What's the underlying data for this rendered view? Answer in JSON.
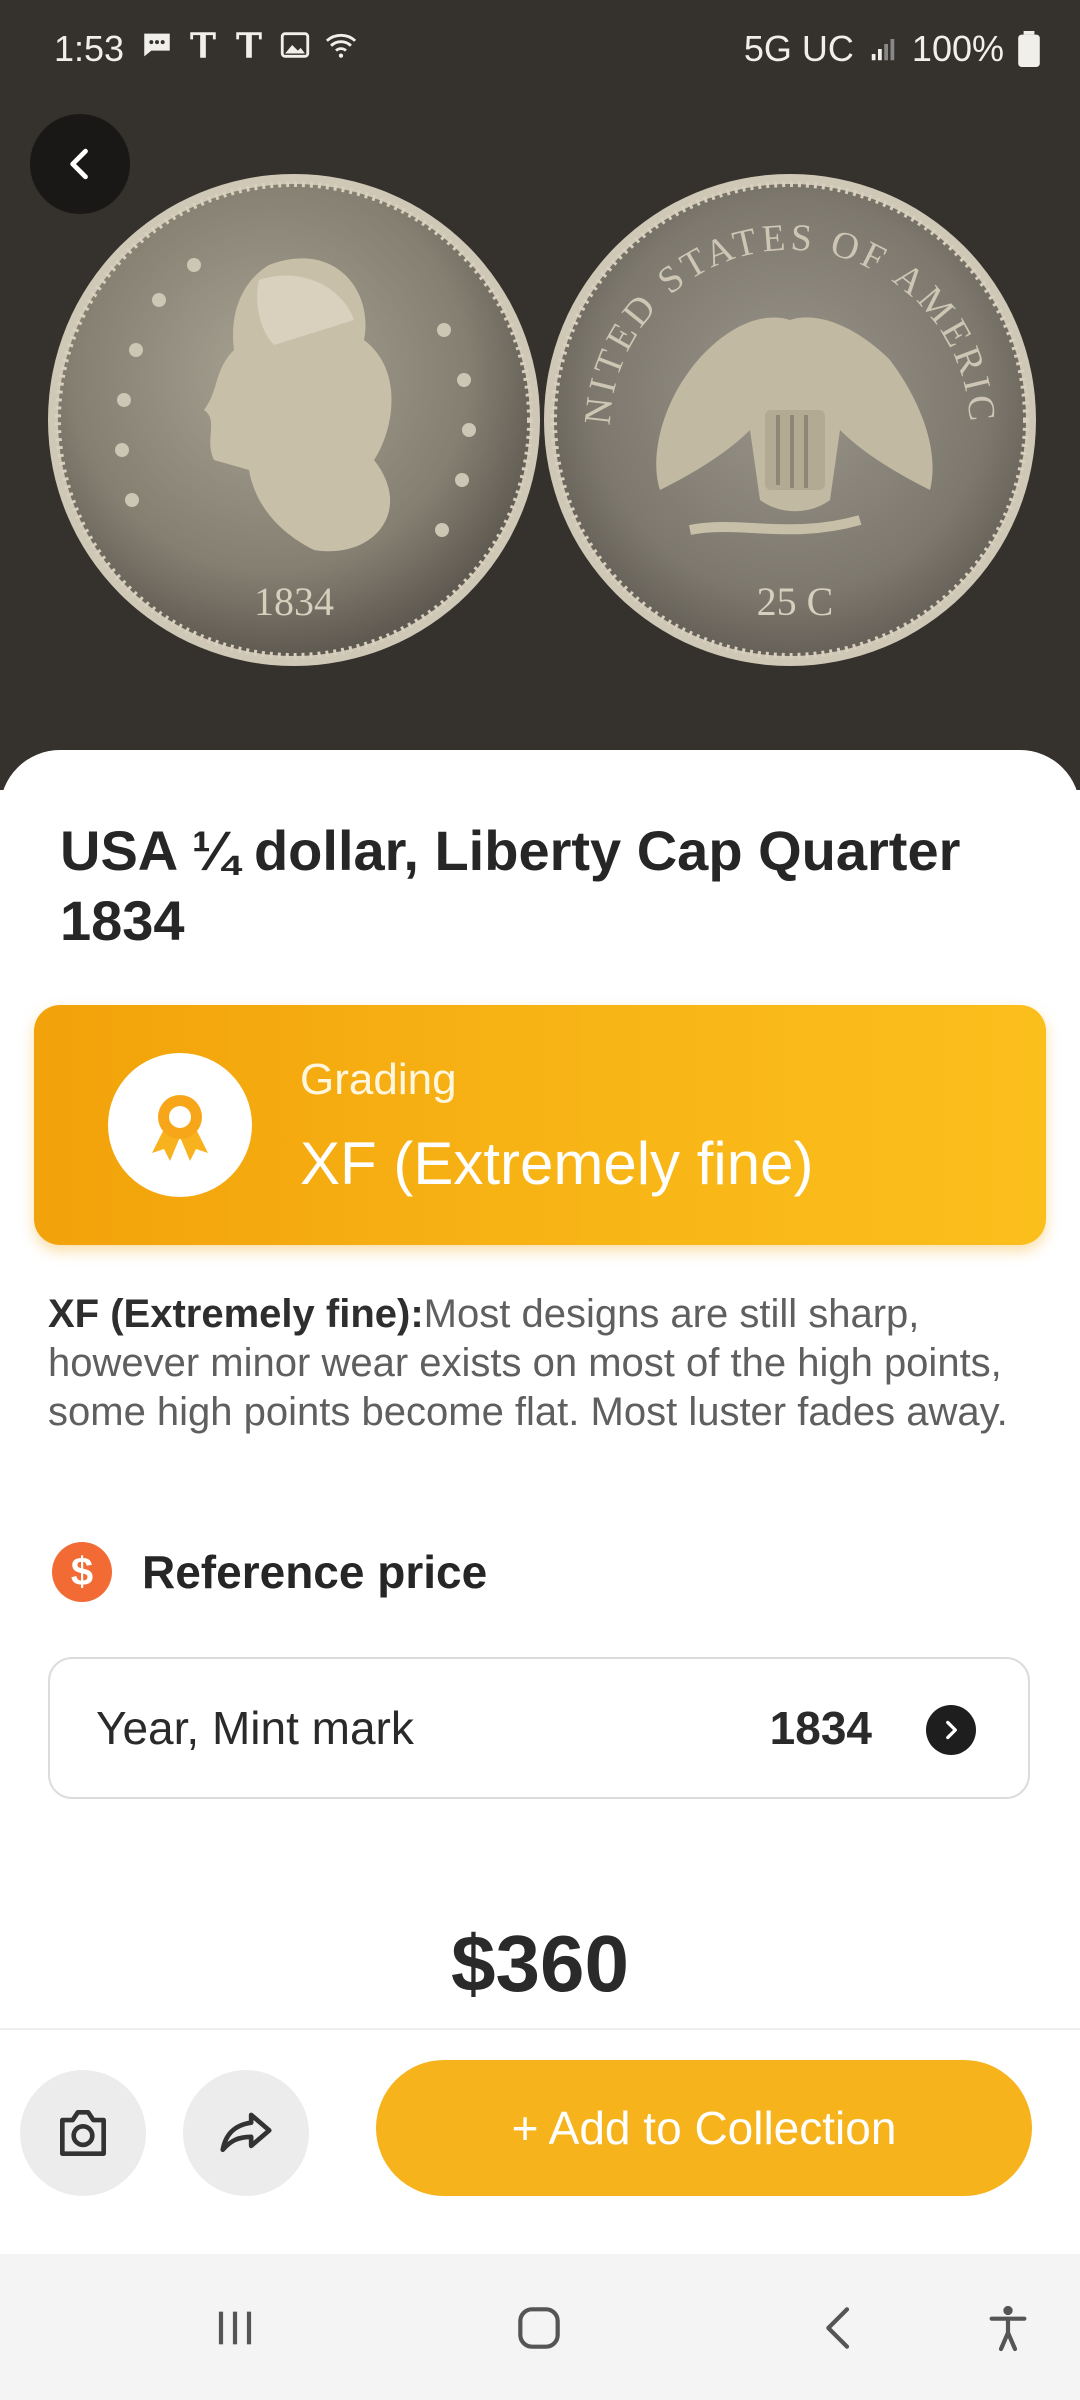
{
  "status_bar": {
    "time": "1:53",
    "network": "5G UC",
    "battery": "100%"
  },
  "hero": {
    "coin_front_year": "1834",
    "coin_back_text": "UNITED STATES OF AMERICA",
    "coin_back_value": "25 C"
  },
  "coin": {
    "title": "USA ¼ dollar, Liberty Cap Quarter 1834"
  },
  "grading": {
    "label": "Grading",
    "value": "XF (Extremely fine)"
  },
  "description": {
    "term": "XF (Extremely fine):",
    "text": "Most designs are still sharp, however minor wear exists on most of the high points, some high points become flat. Most luster fades away."
  },
  "reference": {
    "label": "Reference price",
    "selector_label": "Year, Mint mark",
    "selector_value": "1834",
    "price": "$360"
  },
  "actions": {
    "add_label": "+ Add to Collection"
  },
  "colors": {
    "accent": "#f6b31c",
    "hero_bg": "#35312c",
    "dollar_icon": "#f26b35"
  },
  "icons": [
    "back-icon",
    "camera-icon",
    "share-icon",
    "award-icon",
    "dollar-icon",
    "chevron-right-icon",
    "recent-apps-icon",
    "home-icon",
    "back-nav-icon",
    "accessibility-icon"
  ]
}
